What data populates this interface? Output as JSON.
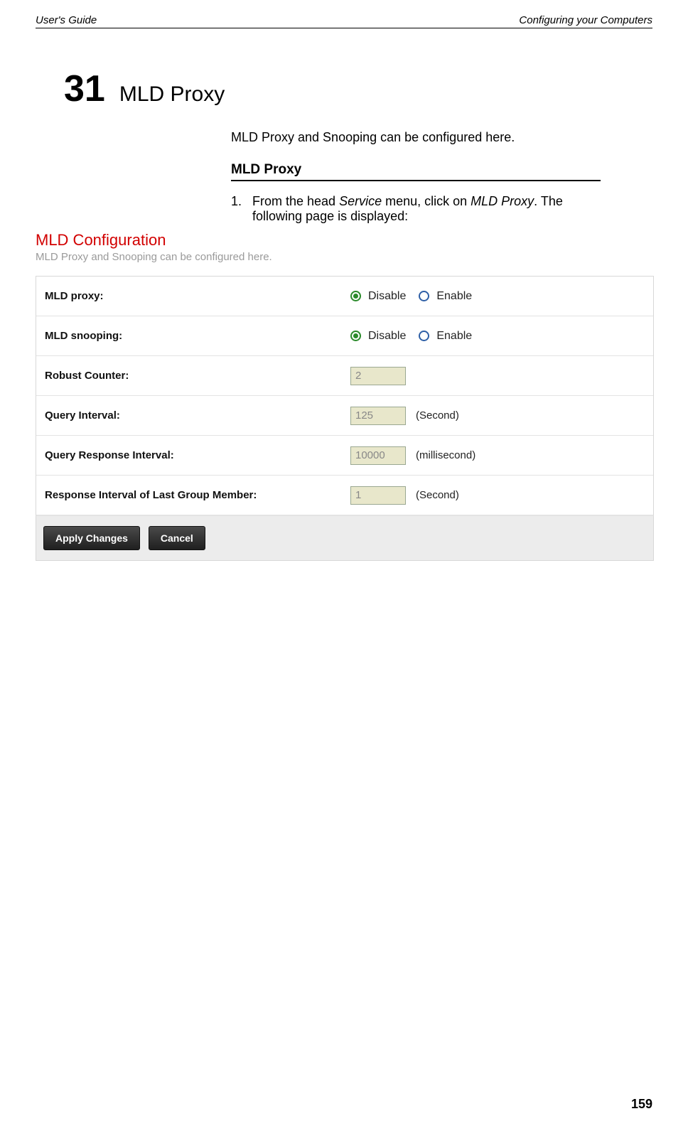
{
  "header": {
    "left": "User's Guide",
    "right": "Configuring your Computers"
  },
  "chapter": {
    "num": "31",
    "title": "MLD Proxy"
  },
  "intro": "MLD Proxy and Snooping can be configured here.",
  "section_heading": "MLD Proxy",
  "step": {
    "num": "1.",
    "t1": "From the head ",
    "i1": "Service",
    "t2": "  menu, click on ",
    "i2": "MLD Proxy",
    "t3": ". The following page is displayed:"
  },
  "screenshot": {
    "title": "MLD Configuration",
    "subtitle": "MLD Proxy and Snooping can be configured here.",
    "rows": {
      "mld_proxy": {
        "label": "MLD proxy:",
        "opt_disable": "Disable",
        "opt_enable": "Enable",
        "selected": "disable"
      },
      "mld_snooping": {
        "label": "MLD snooping:",
        "opt_disable": "Disable",
        "opt_enable": "Enable",
        "selected": "disable"
      },
      "robust": {
        "label": "Robust Counter:",
        "value": "2"
      },
      "query_interval": {
        "label": "Query Interval:",
        "value": "125",
        "unit": "(Second)"
      },
      "query_response": {
        "label": "Query Response Interval:",
        "value": "10000",
        "unit": "(millisecond)"
      },
      "last_member": {
        "label": "Response Interval of Last Group Member:",
        "value": "1",
        "unit": "(Second)"
      }
    },
    "buttons": {
      "apply": "Apply Changes",
      "cancel": "Cancel"
    }
  },
  "page_number": "159"
}
